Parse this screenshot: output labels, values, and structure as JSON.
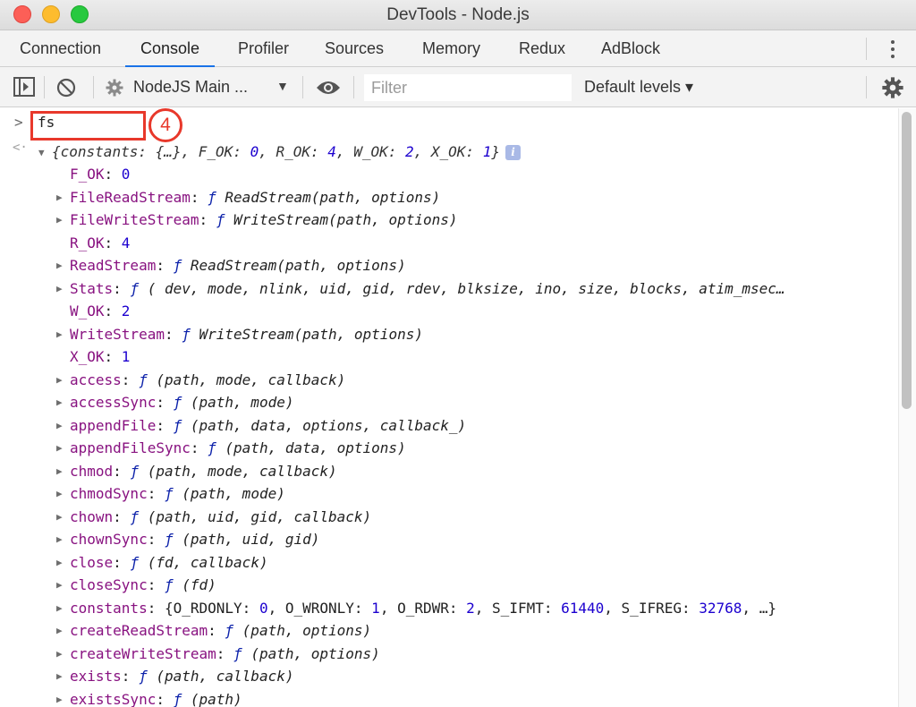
{
  "window": {
    "title": "DevTools - Node.js"
  },
  "tabs": [
    {
      "label": "Connection",
      "active": false
    },
    {
      "label": "Console",
      "active": true
    },
    {
      "label": "Profiler",
      "active": false
    },
    {
      "label": "Sources",
      "active": false
    },
    {
      "label": "Memory",
      "active": false
    },
    {
      "label": "Redux",
      "active": false
    },
    {
      "label": "AdBlock",
      "active": false
    }
  ],
  "toolbar": {
    "context_label": "NodeJS Main ...",
    "filter_placeholder": "Filter",
    "levels_label": "Default levels ▾",
    "icons": [
      "sidebar-toggle-icon",
      "clear-console-icon",
      "gear-icon",
      "dropdown-caret-icon",
      "eye-icon",
      "settings-gear-icon"
    ]
  },
  "console": {
    "input": "fs",
    "callout_number": "4",
    "summary": {
      "open": "{",
      "items": [
        {
          "key": "constants",
          "value": "{…}"
        },
        {
          "key": "F_OK",
          "value": "0"
        },
        {
          "key": "R_OK",
          "value": "4"
        },
        {
          "key": "W_OK",
          "value": "2"
        },
        {
          "key": "X_OK",
          "value": "1"
        }
      ],
      "close": "}"
    },
    "entries": [
      {
        "key": "F_OK",
        "kind": "num",
        "value": "0",
        "expandable": false
      },
      {
        "key": "FileReadStream",
        "kind": "fn",
        "value": "ReadStream(path, options)",
        "expandable": true
      },
      {
        "key": "FileWriteStream",
        "kind": "fn",
        "value": "WriteStream(path, options)",
        "expandable": true
      },
      {
        "key": "R_OK",
        "kind": "num",
        "value": "4",
        "expandable": false
      },
      {
        "key": "ReadStream",
        "kind": "fn",
        "value": "ReadStream(path, options)",
        "expandable": true
      },
      {
        "key": "Stats",
        "kind": "fn",
        "value": "( dev, mode, nlink, uid, gid, rdev, blksize, ino, size, blocks, atim_msec…",
        "expandable": true
      },
      {
        "key": "W_OK",
        "kind": "num",
        "value": "2",
        "expandable": false
      },
      {
        "key": "WriteStream",
        "kind": "fn",
        "value": "WriteStream(path, options)",
        "expandable": true
      },
      {
        "key": "X_OK",
        "kind": "num",
        "value": "1",
        "expandable": false
      },
      {
        "key": "access",
        "kind": "fn",
        "value": "(path, mode, callback)",
        "expandable": true
      },
      {
        "key": "accessSync",
        "kind": "fn",
        "value": "(path, mode)",
        "expandable": true
      },
      {
        "key": "appendFile",
        "kind": "fn",
        "value": "(path, data, options, callback_)",
        "expandable": true
      },
      {
        "key": "appendFileSync",
        "kind": "fn",
        "value": "(path, data, options)",
        "expandable": true
      },
      {
        "key": "chmod",
        "kind": "fn",
        "value": "(path, mode, callback)",
        "expandable": true
      },
      {
        "key": "chmodSync",
        "kind": "fn",
        "value": "(path, mode)",
        "expandable": true
      },
      {
        "key": "chown",
        "kind": "fn",
        "value": "(path, uid, gid, callback)",
        "expandable": true
      },
      {
        "key": "chownSync",
        "kind": "fn",
        "value": "(path, uid, gid)",
        "expandable": true
      },
      {
        "key": "close",
        "kind": "fn",
        "value": "(fd, callback)",
        "expandable": true
      },
      {
        "key": "closeSync",
        "kind": "fn",
        "value": "(fd)",
        "expandable": true
      },
      {
        "key": "constants",
        "kind": "obj",
        "expandable": true,
        "open": "{",
        "close": ", …}",
        "items": [
          {
            "key": "O_RDONLY",
            "value": "0"
          },
          {
            "key": "O_WRONLY",
            "value": "1"
          },
          {
            "key": "O_RDWR",
            "value": "2"
          },
          {
            "key": "S_IFMT",
            "value": "61440"
          },
          {
            "key": "S_IFREG",
            "value": "32768"
          }
        ]
      },
      {
        "key": "createReadStream",
        "kind": "fn",
        "value": "(path, options)",
        "expandable": true
      },
      {
        "key": "createWriteStream",
        "kind": "fn",
        "value": "(path, options)",
        "expandable": true
      },
      {
        "key": "exists",
        "kind": "fn",
        "value": "(path, callback)",
        "expandable": true
      },
      {
        "key": "existsSync",
        "kind": "fn",
        "value": "(path)",
        "expandable": true
      }
    ],
    "fn_glyph": "ƒ",
    "info_badge": "i"
  },
  "colors": {
    "key": "#881280",
    "number": "#1c00cf",
    "function_glyph": "#0d22aa",
    "annotation": "#e8382b",
    "active_tab_underline": "#1a73e8"
  }
}
